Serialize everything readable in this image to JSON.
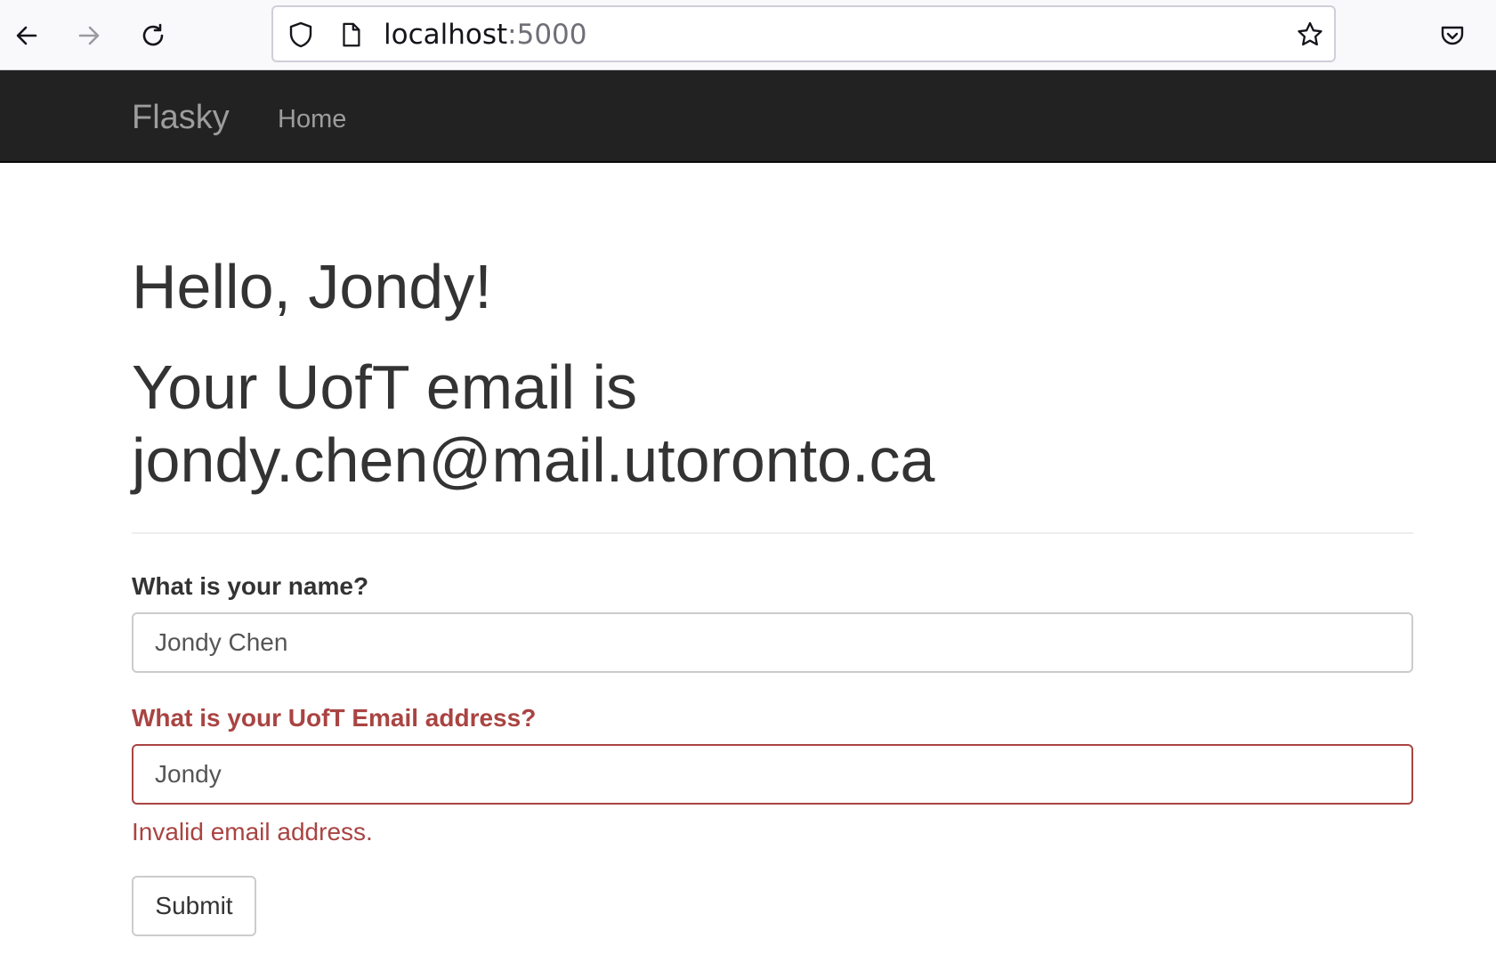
{
  "browser": {
    "url_host": "localhost",
    "url_port": ":5000"
  },
  "navbar": {
    "brand": "Flasky",
    "links": [
      "Home"
    ]
  },
  "main": {
    "greeting": "Hello, Jondy!",
    "email_line_1": "Your UofT email is",
    "email_line_2": "jondy.chen@mail.utoronto.ca"
  },
  "form": {
    "name_label": "What is your name?",
    "name_value": "Jondy Chen",
    "email_label": "What is your UofT Email address?",
    "email_value": "Jondy",
    "email_error": "Invalid email address.",
    "submit_label": "Submit"
  },
  "colors": {
    "navbar_bg": "#222222",
    "error": "#a94442"
  }
}
